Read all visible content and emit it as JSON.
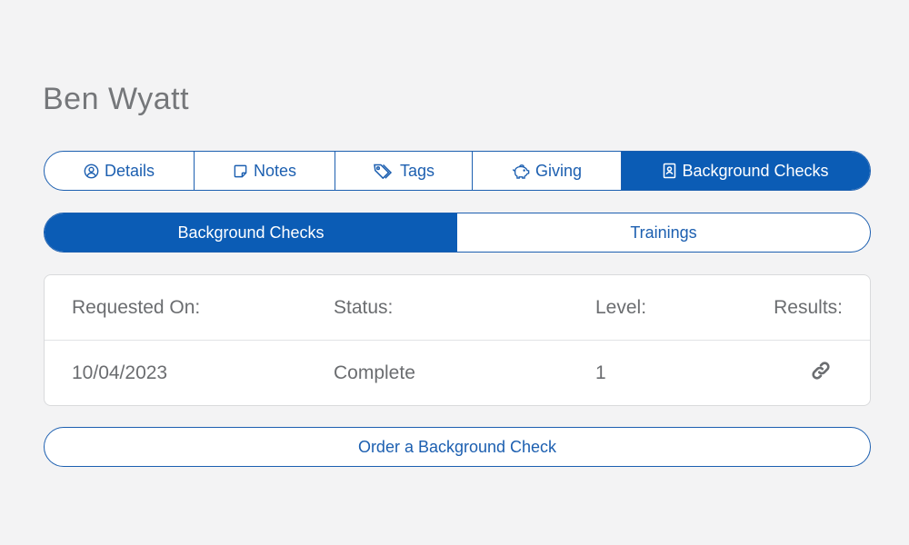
{
  "person": {
    "name": "Ben Wyatt"
  },
  "tabs": [
    {
      "label": "Details",
      "icon": "user-circle-icon",
      "active": false
    },
    {
      "label": "Notes",
      "icon": "note-icon",
      "active": false
    },
    {
      "label": "Tags",
      "icon": "tags-icon",
      "active": false
    },
    {
      "label": "Giving",
      "icon": "piggy-bank-icon",
      "active": false
    },
    {
      "label": "Background Checks",
      "icon": "id-badge-icon",
      "active": true
    }
  ],
  "subtabs": [
    {
      "label": "Background Checks",
      "active": true
    },
    {
      "label": "Trainings",
      "active": false
    }
  ],
  "table": {
    "headers": [
      "Requested On:",
      "Status:",
      "Level:",
      "Results:"
    ],
    "rows": [
      {
        "requested_on": "10/04/2023",
        "status": "Complete",
        "level": "1",
        "results_icon": "link-icon"
      }
    ]
  },
  "actions": {
    "order_label": "Order a Background Check"
  },
  "colors": {
    "accent": "#0b5cb5",
    "background": "#f3f3f4",
    "text_muted": "#6b6d70"
  }
}
